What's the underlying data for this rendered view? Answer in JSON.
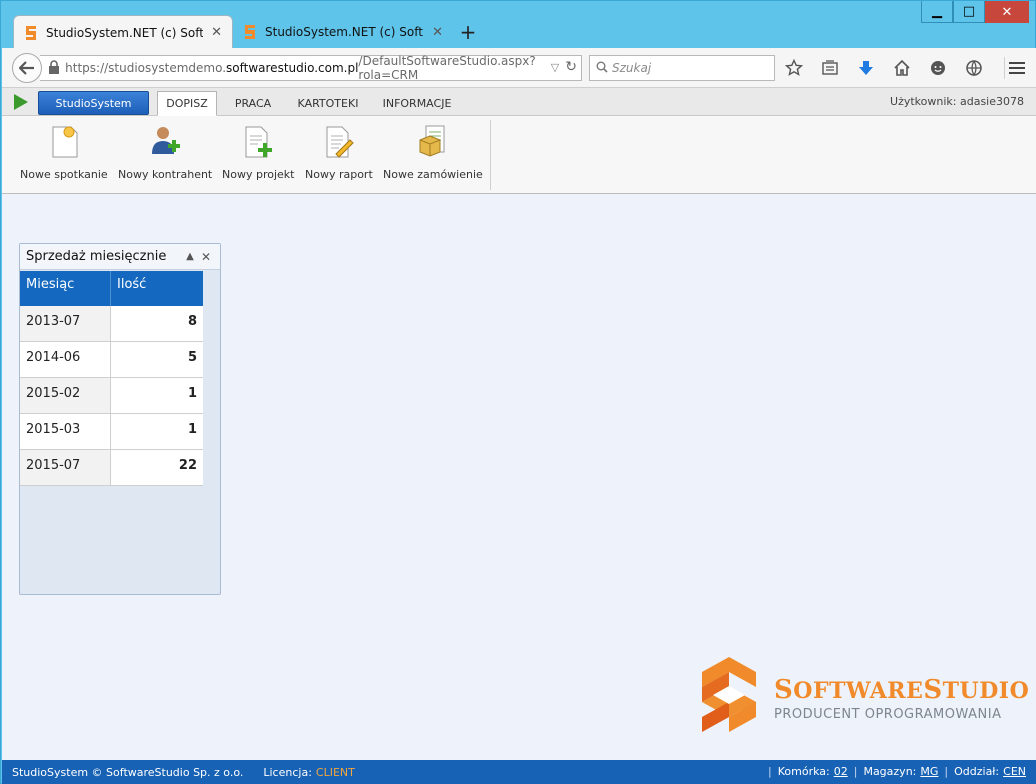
{
  "window": {
    "controls": {
      "minimize": "▁",
      "maximize": "□",
      "close": "✕"
    }
  },
  "browser": {
    "tabs": [
      {
        "title": "StudioSystem.NET (c) Soft...",
        "active": true
      },
      {
        "title": "StudioSystem.NET (c) Soft...",
        "active": false
      }
    ],
    "newtab_label": "+",
    "url": {
      "prefix": "https://studiosystemdemo.",
      "domain": "softwarestudio.com.pl",
      "path": "/DefaultSoftwareStudio.aspx?rola=CRM"
    },
    "search_placeholder": "Szukaj",
    "nav_icons": [
      "bookmark-star-icon",
      "reading-list-icon",
      "download-icon",
      "home-icon",
      "chat-icon",
      "globe-icon"
    ]
  },
  "app": {
    "menu_button": "StudioSystem",
    "tabs": [
      "DOPISZ",
      "PRACA",
      "KARTOTEKI",
      "INFORMACJE"
    ],
    "active_tab": "DOPISZ",
    "user_label": "Użytkownik: adasie3078",
    "ribbon_buttons": [
      {
        "label": "Nowe spotkanie",
        "icon": "new-meeting-icon"
      },
      {
        "label": "Nowy kontrahent",
        "icon": "new-contractor-icon"
      },
      {
        "label": "Nowy projekt",
        "icon": "new-project-icon"
      },
      {
        "label": "Nowy raport",
        "icon": "new-report-icon"
      },
      {
        "label": "Nowe zamówienie",
        "icon": "new-order-icon"
      }
    ]
  },
  "widget": {
    "title": "Sprzedaż miesięcznie",
    "columns": [
      "Miesiąc",
      "Ilość"
    ],
    "rows": [
      {
        "month": "2013-07",
        "qty": "8"
      },
      {
        "month": "2014-06",
        "qty": "5"
      },
      {
        "month": "2015-02",
        "qty": "1"
      },
      {
        "month": "2015-03",
        "qty": "1"
      },
      {
        "month": "2015-07",
        "qty": "22"
      }
    ]
  },
  "logo": {
    "title_prefix_s": "S",
    "title_mid": "OFTWARE",
    "title_s2": "S",
    "title_end": "TUDIO",
    "subtitle": "PRODUCENT OPROGRAMOWANIA"
  },
  "status": {
    "copyright": "StudioSystem © SoftwareStudio Sp. z o.o.",
    "license_label": "Licencja:",
    "license_value": "CLIENT",
    "cell_label": "Komórka:",
    "cell_value": "02",
    "warehouse_label": "Magazyn:",
    "warehouse_value": "MG",
    "branch_label": "Oddział:",
    "branch_value": "CEN"
  },
  "colors": {
    "accent_blue": "#1762b5",
    "grid_header": "#1468c0",
    "logo_orange": "#f08a2a",
    "license_orange": "#f1a53d"
  }
}
